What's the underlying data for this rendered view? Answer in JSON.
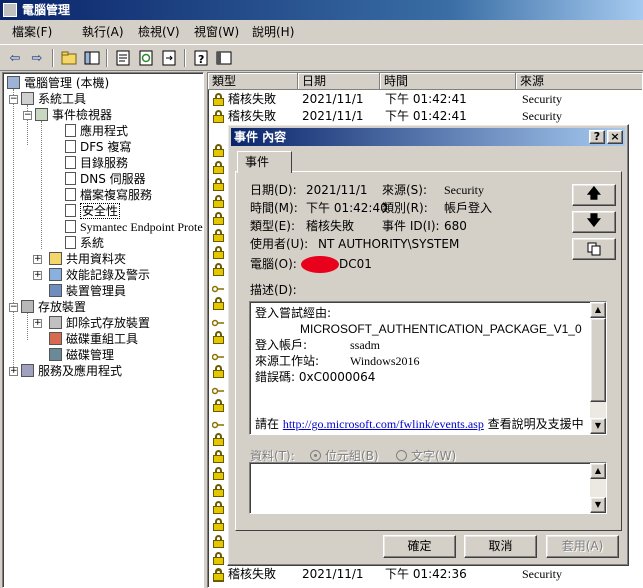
{
  "window": {
    "title": "電腦管理"
  },
  "menu": [
    "檔案(F)",
    "執行(A)",
    "檢視(V)",
    "視窗(W)",
    "說明(H)"
  ],
  "tree": {
    "root": "電腦管理 (本機)",
    "system_tools": "系統工具",
    "event_viewer": "事件檢視器",
    "logs": [
      "應用程式",
      "DFS 複寫",
      "目錄服務",
      "DNS 伺服器",
      "檔案複寫服務",
      "安全性",
      "Symantec Endpoint Prote",
      "系統"
    ],
    "shared_folders": "共用資料夾",
    "perf_logs": "效能記錄及警示",
    "device_manager": "裝置管理員",
    "storage": "存放裝置",
    "removable": "卸除式存放裝置",
    "defrag": "磁碟重組工具",
    "disk_mgmt": "磁碟管理",
    "services_apps": "服務及應用程式"
  },
  "list": {
    "columns": [
      "類型",
      "日期",
      "時間",
      "來源"
    ],
    "top_rows": [
      {
        "type": "稽核失敗",
        "date": "2021/11/1",
        "time": "下午 01:42:41",
        "source": "Security"
      },
      {
        "type": "稽核失敗",
        "date": "2021/11/1",
        "time": "下午 01:42:41",
        "source": "Security"
      }
    ],
    "bottom_rows": [
      {
        "type": "稽核失敗",
        "date": "2021/11/1",
        "time": "下午 01:42:36",
        "source": "Security"
      }
    ]
  },
  "dialog": {
    "title": "事件 內容",
    "help_btn": "?",
    "close_btn": "×",
    "tab": "事件",
    "date_label": "日期(D):",
    "date_value": "2021/11/1",
    "source_label": "來源(S):",
    "source_value": "Security",
    "time_label": "時間(M):",
    "time_value": "下午 01:42:40",
    "category_label": "類別(R):",
    "category_value": "帳戶登入",
    "type_label": "類型(E):",
    "type_value": "稽核失敗",
    "eventid_label": "事件 ID(I):",
    "eventid_value": "680",
    "user_label": "使用者(U):",
    "user_value": "NT AUTHORITY\\SYSTEM",
    "computer_label": "電腦(O):",
    "computer_value": "DC01",
    "desc_label": "描述(D):",
    "desc_lines": [
      "登入嘗試經由:",
      "MICROSOFT_AUTHENTICATION_PACKAGE_V1_0",
      "登入帳戶:",
      "ssadm",
      "來源工作站:",
      "Windows2016",
      "錯誤碼:  0xC0000064"
    ],
    "help_prefix": "請在",
    "help_link": "http://go.microsoft.com/fwlink/events.asp",
    "help_suffix": "查看說明及支援中",
    "data_label": "資料(T):",
    "bytes_label": "位元組(B)",
    "words_label": "文字(W)",
    "ok": "確定",
    "cancel": "取消",
    "apply": "套用(A)"
  },
  "colors": {
    "titlebar": "#0a246a",
    "redaction": "#e8001c",
    "link": "#0000cc"
  }
}
